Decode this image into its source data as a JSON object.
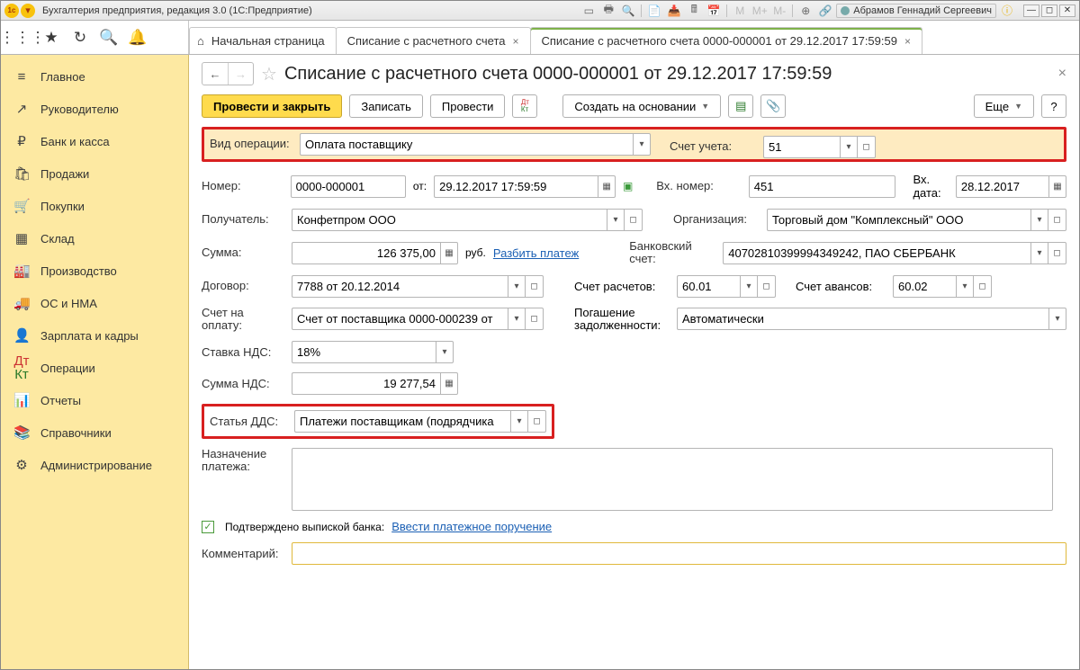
{
  "titlebar": {
    "title": "Бухгалтерия предприятия, редакция 3.0  (1С:Предприятие)",
    "user": "Абрамов Геннадий Сергеевич",
    "mPlus": "M+",
    "mMinus": "M-"
  },
  "tabs": {
    "home": "Начальная страница",
    "t1": "Списание с расчетного счета",
    "t2": "Списание с расчетного счета 0000-000001 от 29.12.2017 17:59:59"
  },
  "sidebar": {
    "items": [
      {
        "icon": "≡",
        "label": "Главное"
      },
      {
        "icon": "↗",
        "label": "Руководителю"
      },
      {
        "icon": "₽",
        "label": "Банк и касса"
      },
      {
        "icon": "🛍",
        "label": "Продажи"
      },
      {
        "icon": "🛒",
        "label": "Покупки"
      },
      {
        "icon": "▦",
        "label": "Склад"
      },
      {
        "icon": "🏭",
        "label": "Производство"
      },
      {
        "icon": "🚚",
        "label": "ОС и НМА"
      },
      {
        "icon": "👤",
        "label": "Зарплата и кадры"
      },
      {
        "icon": "Дт",
        "label": "Операции"
      },
      {
        "icon": "📊",
        "label": "Отчеты"
      },
      {
        "icon": "📚",
        "label": "Справочники"
      },
      {
        "icon": "⚙",
        "label": "Администрирование"
      }
    ]
  },
  "page": {
    "title": "Списание с расчетного счета 0000-000001 от 29.12.2017 17:59:59"
  },
  "cmd": {
    "post_close": "Провести и закрыть",
    "write": "Записать",
    "post": "Провести",
    "create_based": "Создать на основании",
    "more": "Еще",
    "help": "?"
  },
  "labels": {
    "op_type": "Вид операции:",
    "account": "Счет учета:",
    "number": "Номер:",
    "from": "от:",
    "in_number": "Вх. номер:",
    "in_date": "Вх. дата:",
    "payee": "Получатель:",
    "org": "Организация:",
    "sum": "Сумма:",
    "rub": "руб.",
    "split": "Разбить платеж",
    "bank_acct": "Банковский счет:",
    "contract": "Договор:",
    "settle_acct": "Счет расчетов:",
    "advance_acct": "Счет авансов:",
    "invoice": "Счет на оплату:",
    "debt": "Погашение задолженности:",
    "vat_rate": "Ставка НДС:",
    "vat_sum": "Сумма НДС:",
    "dds": "Статья ДДС:",
    "purpose": "Назначение платежа:",
    "confirmed": "Подтверждено выпиской банка:",
    "enter_po": "Ввести платежное поручение",
    "comment": "Комментарий:"
  },
  "values": {
    "op_type": "Оплата поставщику",
    "account": "51",
    "number": "0000-000001",
    "date": "29.12.2017 17:59:59",
    "in_number": "451",
    "in_date": "28.12.2017",
    "payee": "Конфетпром ООО",
    "org": "Торговый дом \"Комплексный\" ООО",
    "sum": "126 375,00",
    "bank_acct": "40702810399994349242, ПАО СБЕРБАНК",
    "contract": "7788 от 20.12.2014",
    "settle_acct": "60.01",
    "advance_acct": "60.02",
    "invoice": "Счет от поставщика 0000-000239 от",
    "debt": "Автоматически",
    "vat_rate": "18%",
    "vat_sum": "19 277,54",
    "dds": "Платежи поставщикам (подрядчика",
    "comment": ""
  }
}
